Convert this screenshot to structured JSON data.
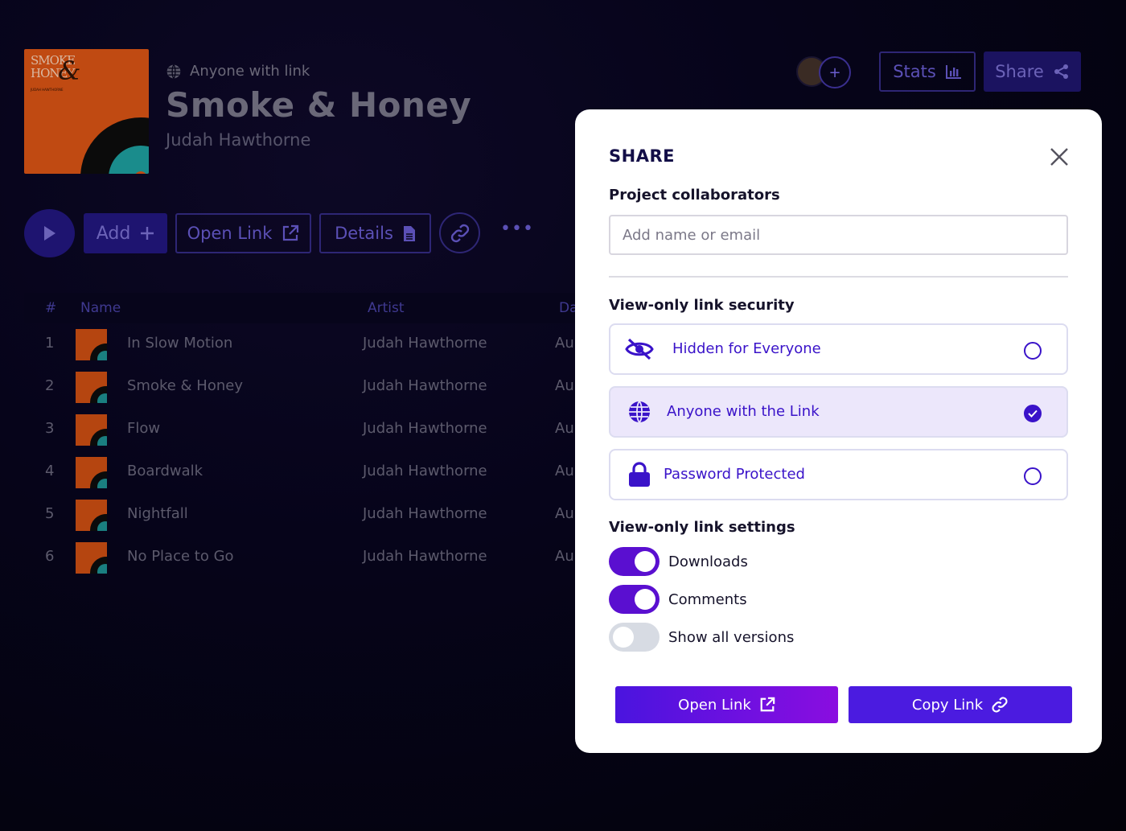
{
  "header": {
    "visibility": "Anyone with link",
    "title": "Smoke & Honey",
    "artist": "Judah Hawthorne",
    "cover": {
      "line1": "SMOKE",
      "line2": "HONEY",
      "amp": "&",
      "credit": "JUDAH HAWTHORNE"
    },
    "stats_label": "Stats",
    "share_label": "Share",
    "add_collab": "+"
  },
  "toolbar": {
    "add_label": "Add",
    "open_link_label": "Open Link",
    "details_label": "Details",
    "more": "•••"
  },
  "table": {
    "headers": {
      "num": "#",
      "name": "Name",
      "artist": "Artist",
      "date": "Da"
    },
    "rows": [
      {
        "num": "1",
        "name": "In Slow Motion",
        "artist": "Judah Hawthorne",
        "date": "Au"
      },
      {
        "num": "2",
        "name": "Smoke & Honey",
        "artist": "Judah Hawthorne",
        "date": "Au"
      },
      {
        "num": "3",
        "name": "Flow",
        "artist": "Judah Hawthorne",
        "date": "Au"
      },
      {
        "num": "4",
        "name": "Boardwalk",
        "artist": "Judah Hawthorne",
        "date": "Au"
      },
      {
        "num": "5",
        "name": "Nightfall",
        "artist": "Judah Hawthorne",
        "date": "Au"
      },
      {
        "num": "6",
        "name": "No Place to Go",
        "artist": "Judah Hawthorne",
        "date": "Au"
      }
    ]
  },
  "modal": {
    "title": "SHARE",
    "collaborators_label": "Project collaborators",
    "collaborators_placeholder": "Add name or email",
    "security_label": "View-only link security",
    "options": [
      {
        "label": "Hidden for Everyone",
        "icon": "eye-slash-icon",
        "selected": false
      },
      {
        "label": "Anyone with the Link",
        "icon": "globe-icon",
        "selected": true
      },
      {
        "label": "Password Protected",
        "icon": "lock-icon",
        "selected": false
      }
    ],
    "settings_label": "View-only link settings",
    "toggles": [
      {
        "label": "Downloads",
        "on": true
      },
      {
        "label": "Comments",
        "on": true
      },
      {
        "label": "Show all versions",
        "on": false
      }
    ],
    "open_link_label": "Open Link",
    "copy_link_label": "Copy Link"
  },
  "colors": {
    "accent": "#3a13c9",
    "toggle_on": "#5a0fd0",
    "selected_bg": "#ece7fb",
    "background": "#05030f"
  }
}
